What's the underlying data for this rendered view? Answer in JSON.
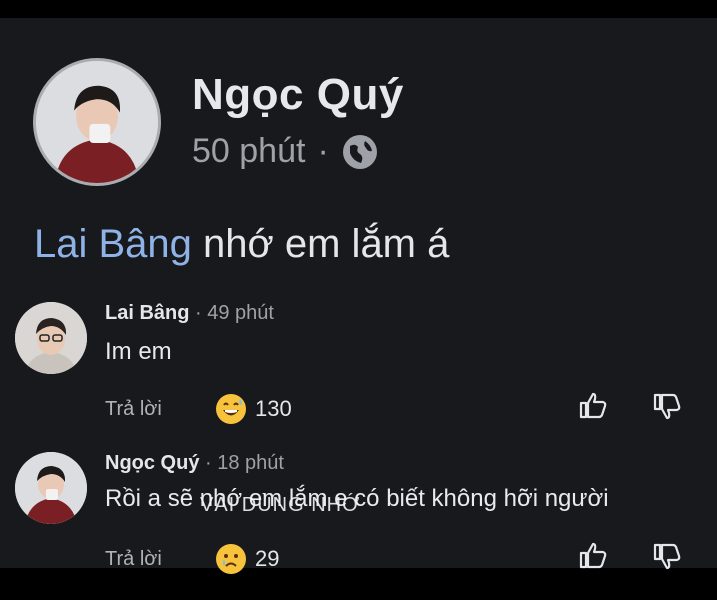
{
  "post": {
    "author": "Ngọc Quý",
    "time": "50 phút",
    "separator": "·",
    "privacy_icon": "globe-icon",
    "mention": "Lai Bâng",
    "text": " nhớ em lắm á"
  },
  "comments": [
    {
      "author": "Lai Bâng",
      "time": "· 49 phút",
      "text": "Im em",
      "reply_label": "Trả lời",
      "reaction_icon": "grin-sweat-emoji",
      "reaction_count": "130"
    },
    {
      "author": "Ngọc Quý",
      "time": "· 18 phút",
      "text": "Rồi a sẽ nhớ em lắm e có biết không hỡi người",
      "reply_label": "Trả lời",
      "reaction_icon": "sad-emoji",
      "reaction_count": "29"
    }
  ],
  "watermark": "VÀI DÙNG NHỚ",
  "colors": {
    "background": "#18191c",
    "mention": "#8fb3e6",
    "muted": "#9ea2a8"
  }
}
